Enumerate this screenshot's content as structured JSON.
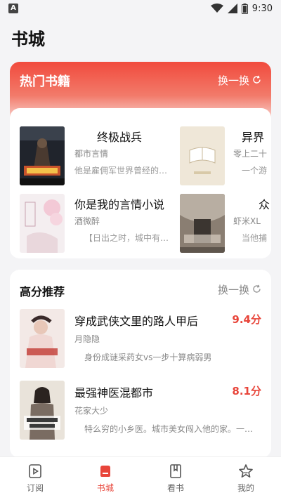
{
  "status_bar": {
    "app_badge": "A",
    "time": "9:30"
  },
  "page_title": "书城",
  "hot_books": {
    "title": "热门书籍",
    "refresh_label": "换一换",
    "books": [
      {
        "title": "终极战兵",
        "author": "都市言情",
        "desc": "他是雇佣军世界曾经的…"
      },
      {
        "title": "异界",
        "author": "零上二十",
        "desc": "一个游"
      },
      {
        "title": "你是我的言情小说",
        "author": "酒微醉",
        "desc": "【日出之时，城中有…"
      },
      {
        "title": "众",
        "author": "虾米XL",
        "desc": "当他捕"
      }
    ]
  },
  "recommended": {
    "title": "高分推荐",
    "refresh_label": "换一换",
    "items": [
      {
        "title": "穿成武侠文里的路人甲后",
        "score": "9.4分",
        "author": "月隐隐",
        "desc": "身份成谜采药女vs一步十算病弱男"
      },
      {
        "title": "最强神医混都市",
        "score": "8.1分",
        "author": "花家大少",
        "desc": "特么穷的小乡医。城市美女闯入他的家。一…"
      }
    ]
  },
  "tabs": [
    {
      "label": "订阅"
    },
    {
      "label": "书城"
    },
    {
      "label": "看书"
    },
    {
      "label": "我的"
    }
  ],
  "colors": {
    "accent": "#e8453a",
    "header_gradient_top": "#f14a3d"
  }
}
